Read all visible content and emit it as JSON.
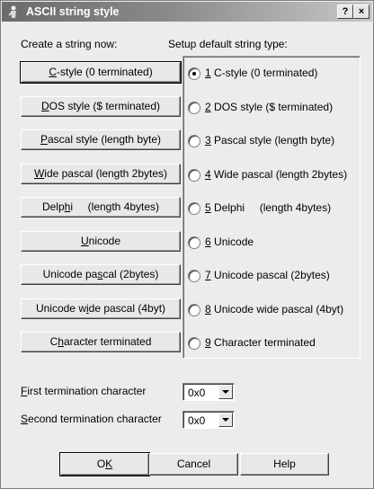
{
  "window": {
    "title": "ASCII string style",
    "help_btn": "?",
    "close_btn": "×"
  },
  "create_label": "Create a string now:",
  "setup_label": "Setup default string type:",
  "buttons": [
    {
      "pre": "",
      "u": "C",
      "post": "-style (0 terminated)"
    },
    {
      "pre": "",
      "u": "D",
      "post": "OS style ($ terminated)"
    },
    {
      "pre": "",
      "u": "P",
      "post": "ascal style (length byte)"
    },
    {
      "pre": "",
      "u": "W",
      "post": "ide pascal (length 2bytes)"
    },
    {
      "pre": "Delp",
      "u": "h",
      "post": "i     (length 4bytes)"
    },
    {
      "pre": "",
      "u": "U",
      "post": "nicode"
    },
    {
      "pre": "Unicode pa",
      "u": "s",
      "post": "cal (2bytes)"
    },
    {
      "pre": "Unicode w",
      "u": "i",
      "post": "de pascal (4byt)"
    },
    {
      "pre": "C",
      "u": "h",
      "post": "aracter terminated"
    }
  ],
  "radios": [
    {
      "u": "1",
      "text": " C-style (0 terminated)",
      "checked": true
    },
    {
      "u": "2",
      "text": " DOS style ($ terminated)",
      "checked": false
    },
    {
      "u": "3",
      "text": " Pascal style (length byte)",
      "checked": false
    },
    {
      "u": "4",
      "text": " Wide pascal (length 2bytes)",
      "checked": false
    },
    {
      "u": "5",
      "text": " Delphi     (length 4bytes)",
      "checked": false
    },
    {
      "u": "6",
      "text": " Unicode",
      "checked": false
    },
    {
      "u": "7",
      "text": " Unicode pascal (2bytes)",
      "checked": false
    },
    {
      "u": "8",
      "text": " Unicode wide pascal (4byt)",
      "checked": false
    },
    {
      "u": "9",
      "text": " Character terminated",
      "checked": false
    }
  ],
  "first_term": {
    "u": "F",
    "rest": "irst termination character",
    "value": "0x0"
  },
  "second_term": {
    "u": "S",
    "rest": "econd termination character",
    "value": "0x0"
  },
  "ok": {
    "pre": "O",
    "u": "K",
    "post": ""
  },
  "cancel": "Cancel",
  "help": "Help"
}
